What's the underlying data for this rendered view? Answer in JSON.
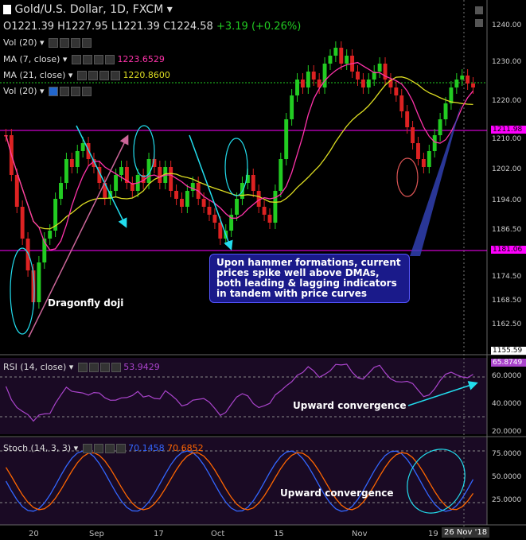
{
  "header": {
    "symbol": "Gold/U.S. Dollar, 1D, FXCM",
    "open": "O1221.39",
    "high": "H1227.95",
    "low": "L1221.39",
    "close": "C1224.58",
    "change": "+3.19 (+0.26%)"
  },
  "legends": {
    "vol1": "Vol (20)",
    "ma7": "MA (7, close)",
    "ma7_value": "1223.6529",
    "ma21": "MA (21, close)",
    "ma21_value": "1220.8600",
    "vol2": "Vol (20)",
    "rsi": "RSI (14, close)",
    "rsi_value": "53.9429",
    "stoch": "Stoch (14, 3, 3)",
    "stoch_k": "70.1458",
    "stoch_d": "70.6852"
  },
  "price_axis": [
    "1240.00",
    "1230.00",
    "1220.00",
    "1210.00",
    "1202.00",
    "1194.00",
    "1186.50",
    "1174.50",
    "1168.50",
    "1162.50",
    "1155.59"
  ],
  "price_tags": {
    "level1": "1211.98",
    "level2": "1181.06",
    "last": "1155.59"
  },
  "rsi_axis": [
    "65.8749",
    "60.0000",
    "40.0000",
    "20.0000"
  ],
  "stoch_axis": [
    "75.0000",
    "50.0000",
    "25.0000"
  ],
  "x_labels": [
    "20",
    "Sep",
    "17",
    "Oct",
    "15",
    "Nov",
    "19"
  ],
  "date_badge": "26 Nov '18",
  "annotations": {
    "main_box": "Upon hammer formations, current prices spike well above DMAs, both leading & lagging indicators in tandem with price curves",
    "dragonfly": "Dragonfly doji",
    "rsi_note": "Upward convergence",
    "stoch_note": "Upward convergence"
  },
  "colors": {
    "bull": "#22cc22",
    "bear": "#dd2222",
    "ma7": "#ff33aa",
    "ma21": "#dddd22",
    "rsi": "#aa44cc",
    "stoch_k": "#3366ff",
    "stoch_d": "#ff6600",
    "level_line": "#ff00ff",
    "arrow_cyan": "#22ddee",
    "arrow_pink": "#cc6699",
    "arrow_blue": "#3344bb"
  }
}
